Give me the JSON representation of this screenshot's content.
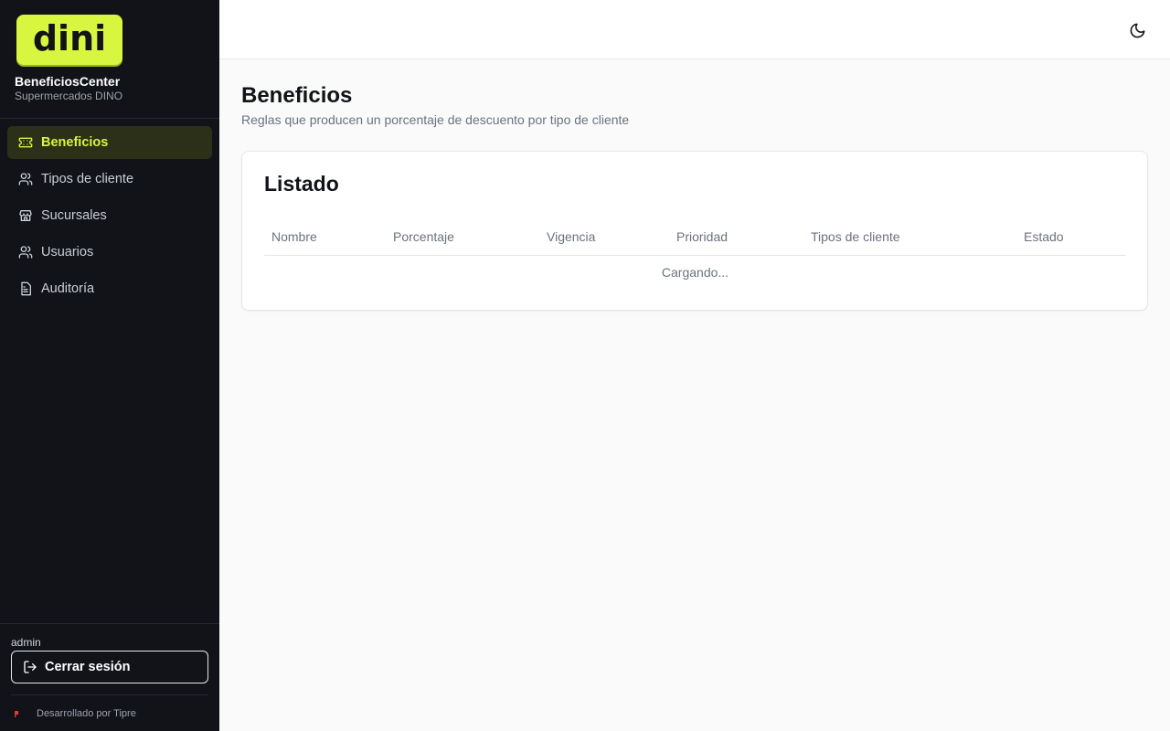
{
  "sidebar": {
    "logo_text": "dini",
    "brand_name": "BeneficiosCenter",
    "brand_sub": "Supermercados DINO",
    "accent_color": "#d8f53f",
    "items": [
      {
        "label": "Beneficios",
        "icon": "ticket-icon",
        "active": true
      },
      {
        "label": "Tipos de cliente",
        "icon": "users-icon",
        "active": false
      },
      {
        "label": "Sucursales",
        "icon": "store-icon",
        "active": false
      },
      {
        "label": "Usuarios",
        "icon": "users-icon",
        "active": false
      },
      {
        "label": "Auditoría",
        "icon": "document-icon",
        "active": false
      }
    ],
    "user": "admin",
    "logout_label": "Cerrar sesión",
    "developer": "Desarrollado por Tipre"
  },
  "topbar": {
    "theme_icon": "moon-icon"
  },
  "main": {
    "title": "Beneficios",
    "subtitle": "Reglas que producen un porcentaje de descuento por tipo de cliente",
    "card": {
      "title": "Listado",
      "columns": [
        "Nombre",
        "Porcentaje",
        "Vigencia",
        "Prioridad",
        "Tipos de cliente",
        "Estado"
      ],
      "loading_text": "Cargando..."
    }
  }
}
